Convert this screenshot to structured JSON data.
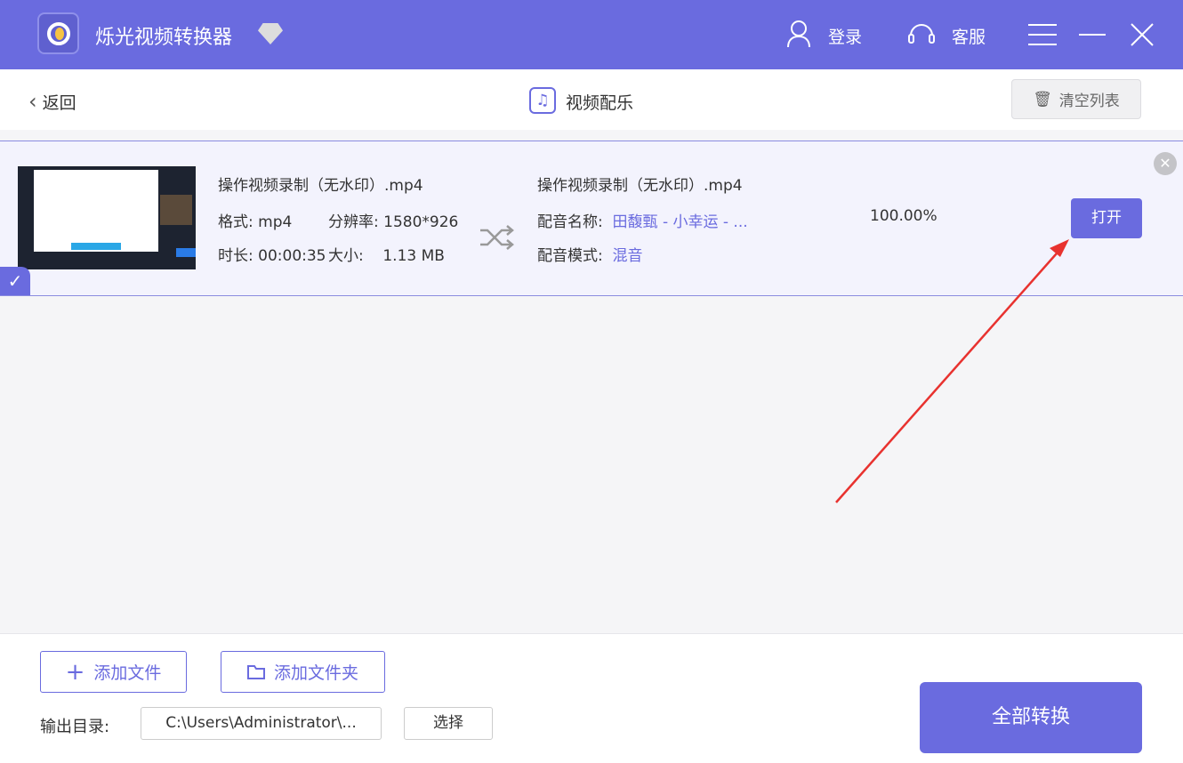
{
  "app": {
    "title": "烁光视频转换器",
    "login": "登录",
    "service": "客服"
  },
  "topbar": {
    "back": "返回",
    "title": "视频配乐",
    "clear": "清空列表"
  },
  "item": {
    "source_name": "操作视频录制（无水印）.mp4",
    "format_label": "格式:",
    "format": "mp4",
    "resolution_label": "分辨率:",
    "resolution": "1580*926",
    "duration_label": "时长:",
    "duration": "00:00:35",
    "size_label": "大小:",
    "size": "1.13 MB",
    "output_name": "操作视频录制（无水印）.mp4",
    "music_label": "配音名称:",
    "music": "田馥甄 - 小幸运 - ...",
    "mode_label": "配音模式:",
    "mode": "混音",
    "progress": "100.00%",
    "open": "打开"
  },
  "footer": {
    "add_file": "添加文件",
    "add_folder": "添加文件夹",
    "output_label": "输出目录:",
    "output_path": "C:\\Users\\Administrator\\...",
    "choose": "选择",
    "convert_all": "全部转换"
  },
  "colors": {
    "accent": "#6a6bdf",
    "arrow": "#e8322f"
  }
}
